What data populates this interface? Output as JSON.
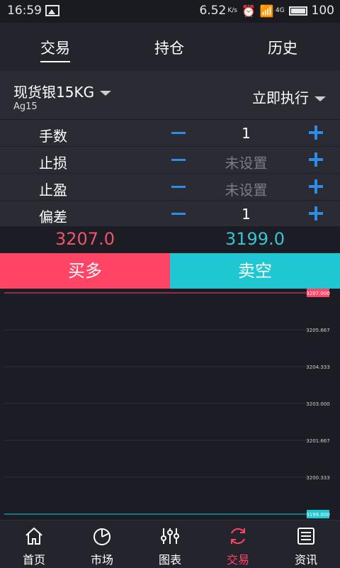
{
  "status": {
    "time": "16:59",
    "speed": "6.52",
    "speed_unit": "K/s",
    "network": "4G",
    "battery": "100"
  },
  "tabs": [
    {
      "label": "交易"
    },
    {
      "label": "持仓"
    },
    {
      "label": "历史"
    }
  ],
  "product": {
    "name": "现货银15KG",
    "code": "Ag15",
    "order_mode": "立即执行"
  },
  "order_rows": [
    {
      "label": "手数",
      "value": "1"
    },
    {
      "label": "止损",
      "value": "未设置"
    },
    {
      "label": "止盈",
      "value": "未设置"
    },
    {
      "label": "偏差",
      "value": "1"
    }
  ],
  "prices": {
    "buy": "3207.0",
    "sell": "3199.0"
  },
  "buttons": {
    "buy": "买多",
    "sell": "卖空"
  },
  "chart_data": {
    "type": "line",
    "y_ticks": [
      "3207.000",
      "3205.667",
      "3204.333",
      "3203.000",
      "3201.667",
      "3200.333",
      "3199.000"
    ],
    "ylim": [
      3199.0,
      3207.0
    ],
    "upper_label": "3207.000",
    "lower_label": "3199.000",
    "colors": {
      "upper": "#ff4466",
      "lower": "#1fc7d3",
      "grid": "#2e2f38"
    }
  },
  "bottom_nav": [
    {
      "label": "首页",
      "icon": "home-icon"
    },
    {
      "label": "市场",
      "icon": "pie-chart-icon"
    },
    {
      "label": "图表",
      "icon": "sliders-icon"
    },
    {
      "label": "交易",
      "icon": "refresh-icon"
    },
    {
      "label": "资讯",
      "icon": "news-icon"
    }
  ],
  "colors": {
    "accent_red": "#ff4466",
    "accent_cyan": "#1fc7d3",
    "accent_blue": "#2c8ce8"
  }
}
